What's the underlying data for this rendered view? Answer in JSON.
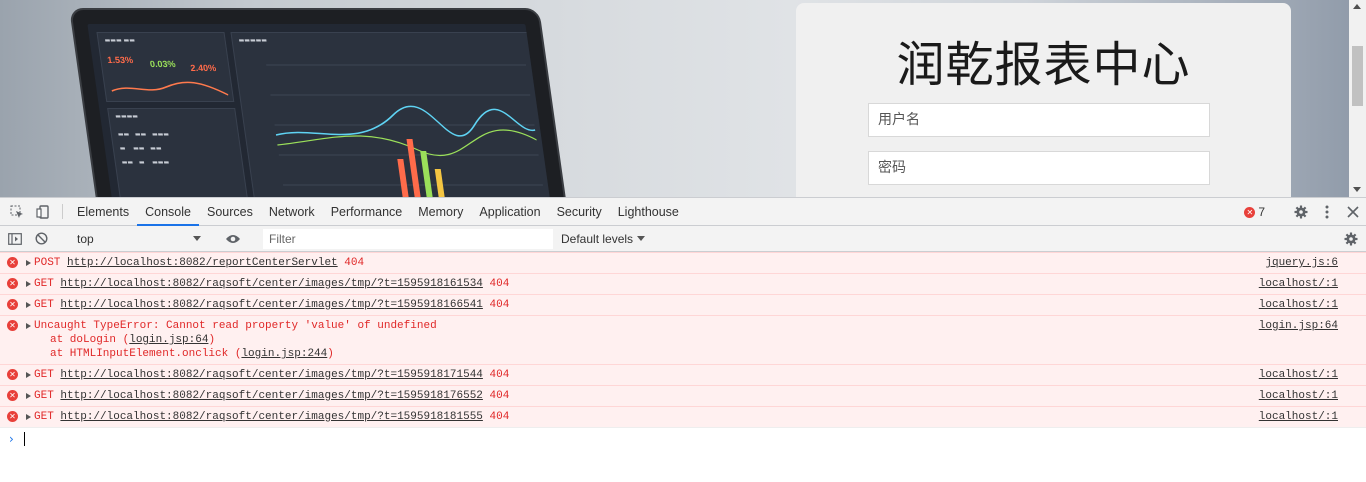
{
  "page": {
    "login": {
      "title": "润乾报表中心",
      "username_placeholder": "用户名",
      "password_placeholder": "密码"
    },
    "dashboard_preview": {
      "kpis": [
        {
          "value": "1.53%",
          "color": "#ff6b4a"
        },
        {
          "value": "0.03%",
          "color": "#9be05a"
        },
        {
          "value": "2.40%",
          "color": "#ff6b4a"
        }
      ]
    }
  },
  "devtools": {
    "tabs": [
      "Elements",
      "Console",
      "Sources",
      "Network",
      "Performance",
      "Memory",
      "Application",
      "Security",
      "Lighthouse"
    ],
    "active_tab": "Console",
    "error_count": "7",
    "toolbar": {
      "context": "top",
      "filter_placeholder": "Filter",
      "levels": "Default levels"
    },
    "messages": [
      {
        "method": "POST",
        "url": "http://localhost:8082/reportCenterServlet",
        "status": "404",
        "source": "jquery.js:6"
      },
      {
        "method": "GET",
        "url": "http://localhost:8082/raqsoft/center/images/tmp/?t=1595918161534",
        "status": "404",
        "source": "localhost/:1"
      },
      {
        "method": "GET",
        "url": "http://localhost:8082/raqsoft/center/images/tmp/?t=1595918166541",
        "status": "404",
        "source": "localhost/:1"
      },
      {
        "error": "Uncaught TypeError: Cannot read property 'value' of undefined",
        "source": "login.jsp:64",
        "stack": [
          {
            "prefix": "at doLogin (",
            "link": "login.jsp:64",
            "suffix": ")"
          },
          {
            "prefix": "at HTMLInputElement.onclick (",
            "link": "login.jsp:244",
            "suffix": ")"
          }
        ]
      },
      {
        "method": "GET",
        "url": "http://localhost:8082/raqsoft/center/images/tmp/?t=1595918171544",
        "status": "404",
        "source": "localhost/:1"
      },
      {
        "method": "GET",
        "url": "http://localhost:8082/raqsoft/center/images/tmp/?t=1595918176552",
        "status": "404",
        "source": "localhost/:1"
      },
      {
        "method": "GET",
        "url": "http://localhost:8082/raqsoft/center/images/tmp/?t=1595918181555",
        "status": "404",
        "source": "localhost/:1"
      }
    ]
  }
}
